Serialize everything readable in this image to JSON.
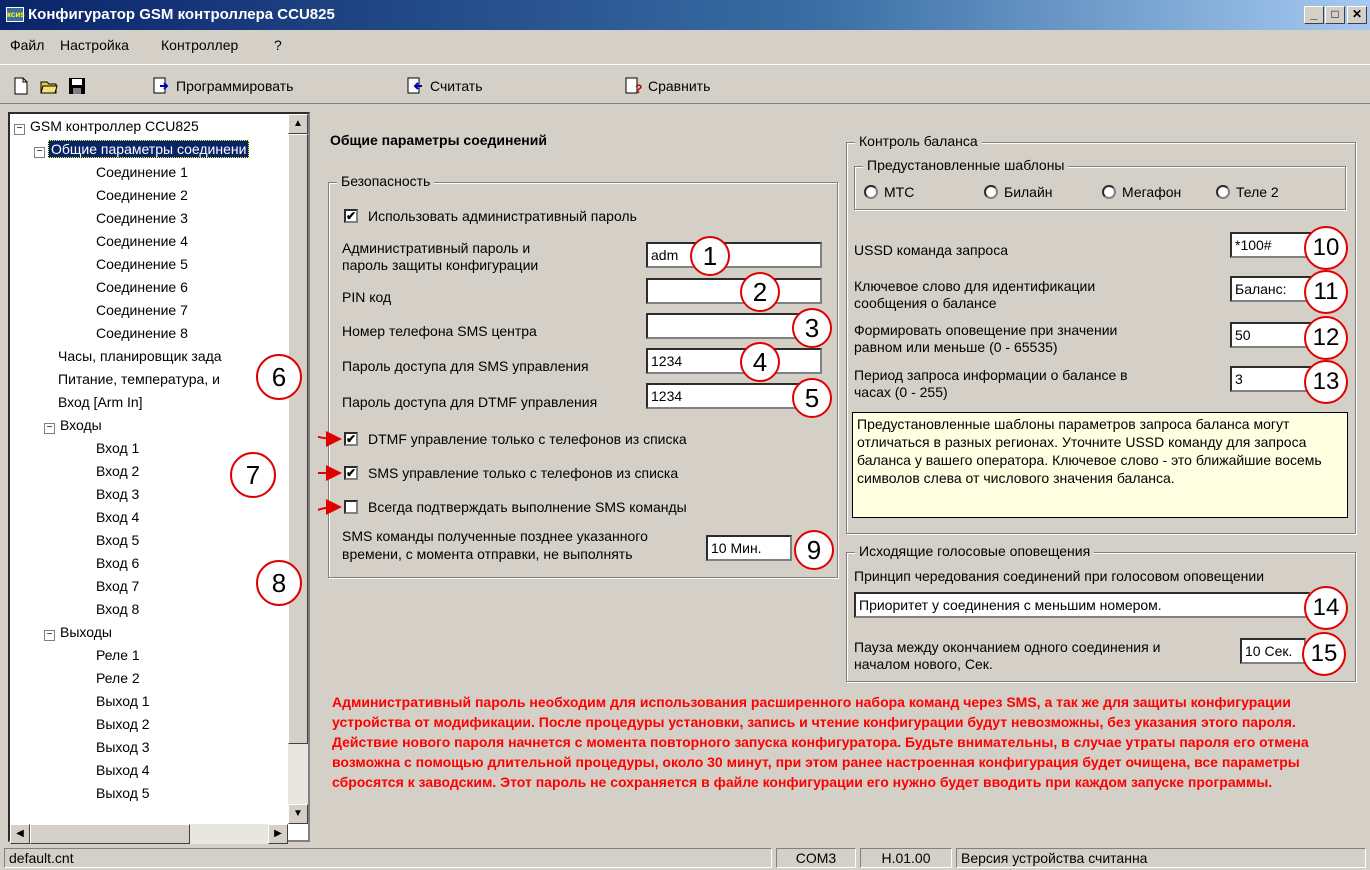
{
  "window": {
    "title": "Конфигуратор GSM контроллера CCU825",
    "icon_text": "ксиs",
    "minimize": "_",
    "maximize": "□",
    "close": "✕"
  },
  "menu": [
    "Файл",
    "Настройка",
    "Контроллер",
    "?"
  ],
  "toolbar": {
    "program": "Программировать",
    "read": "Считать",
    "compare": "Сравнить"
  },
  "tree": {
    "root": "GSM контроллер CCU825",
    "general": "Общие параметры соединени",
    "connections": [
      "Соединение 1",
      "Соединение 2",
      "Соединение 3",
      "Соединение 4",
      "Соединение 5",
      "Соединение 6",
      "Соединение 7",
      "Соединение 8"
    ],
    "clock": "Часы, планировщик зада",
    "power": "Питание, температура, и",
    "arm_in": "Вход [Arm In]",
    "inputs_group": "Входы",
    "inputs": [
      "Вход 1",
      "Вход 2",
      "Вход 3",
      "Вход 4",
      "Вход 5",
      "Вход 6",
      "Вход 7",
      "Вход 8"
    ],
    "outputs_group": "Выходы",
    "outputs": [
      "Реле 1",
      "Реле 2",
      "Выход 1",
      "Выход 2",
      "Выход 3",
      "Выход 4",
      "Выход 5"
    ]
  },
  "main": {
    "heading": "Общие параметры соединений",
    "security": {
      "title": "Безопасность",
      "use_admin_pwd": "Использовать административный пароль",
      "admin_pwd_label_1": "Административный пароль и",
      "admin_pwd_label_2": "пароль защиты конфигурации",
      "admin_pwd_value": "adm",
      "pin_label": "PIN код",
      "pin_value": "",
      "sms_center_label": "Номер телефона SMS центра",
      "sms_center_value": "",
      "sms_pwd_label": "Пароль доступа для SMS управления",
      "sms_pwd_value": "1234",
      "dtmf_pwd_label": "Пароль доступа для DTMF управления",
      "dtmf_pwd_value": "1234",
      "dtmf_only_list": "DTMF управление только с телефонов из списка",
      "sms_only_list": "SMS управление только с телефонов из списка",
      "always_confirm": "Всегда подтверждать выполнение SMS команды",
      "late_sms_label_1": "SMS команды полученные позднее указанного",
      "late_sms_label_2": "времени, с момента отправки, не выполнять",
      "late_sms_value": "10 Мин.",
      "check_mark": "✔"
    },
    "balance": {
      "title": "Контроль баланса",
      "templates_title": "Предустановленные шаблоны",
      "templates": [
        "МТС",
        "Билайн",
        "Мегафон",
        "Теле 2"
      ],
      "ussd_label": "USSD команда запроса",
      "ussd_value": "*100#",
      "keyword_label_1": "Ключевое слово для идентификации",
      "keyword_label_2": "сообщения о балансе",
      "keyword_value": "Баланс:",
      "threshold_label_1": "Формировать оповещение при значении",
      "threshold_label_2": "равном или меньше (0 - 65535)",
      "threshold_value": "50",
      "period_label_1": "Период запроса информации о балансе в",
      "period_label_2": "часах (0 - 255)",
      "period_value": "3",
      "note": "Предустановленные шаблоны параметров запроса баланса могут отличаться в разных регионах. Уточните USSD команду для запроса баланса у вашего оператора. Ключевое слово - это ближайшие восемь символов слева от числового значения баланса."
    },
    "voice": {
      "title": "Исходящие голосовые оповещения",
      "order_label": "Принцип чередования соединений при голосовом оповещении",
      "order_value": "Приоритет у соединения с меньшим номером.",
      "pause_label_1": "Пауза между окончанием одного соединения и",
      "pause_label_2": "началом нового, Сек.",
      "pause_value": "10 Сек."
    },
    "warning": "Административный пароль необходим для использования расширенного набора команд через SMS, а так же для защиты конфигурации устройства от модификации. После процедуры установки, запись и чтение конфигурации будут невозможны, без указания этого пароля. Действие нового пароля начнется с момента повторного запуска конфигуратора. Будьте внимательны, в случае утраты пароля его отмена возможна с помощью длительной процедуры, около 30 минут, при этом ранее настроенная конфигурация будет очищена, все параметры сбросятся к заводским. Этот пароль не сохраняется в файле конфигурации его нужно будет вводить при каждом запуске программы."
  },
  "badges": [
    "1",
    "2",
    "3",
    "4",
    "5",
    "6",
    "7",
    "8",
    "9",
    "10",
    "11",
    "12",
    "13",
    "14",
    "15"
  ],
  "status": {
    "file": "default.cnt",
    "port": "COM3",
    "version": "H.01.00",
    "message": "Версия устройства считанна"
  },
  "colors": {
    "accent": "#0a246a",
    "warning": "#ff0000",
    "badge_border": "#e00000",
    "note_bg": "#ffffe1"
  }
}
